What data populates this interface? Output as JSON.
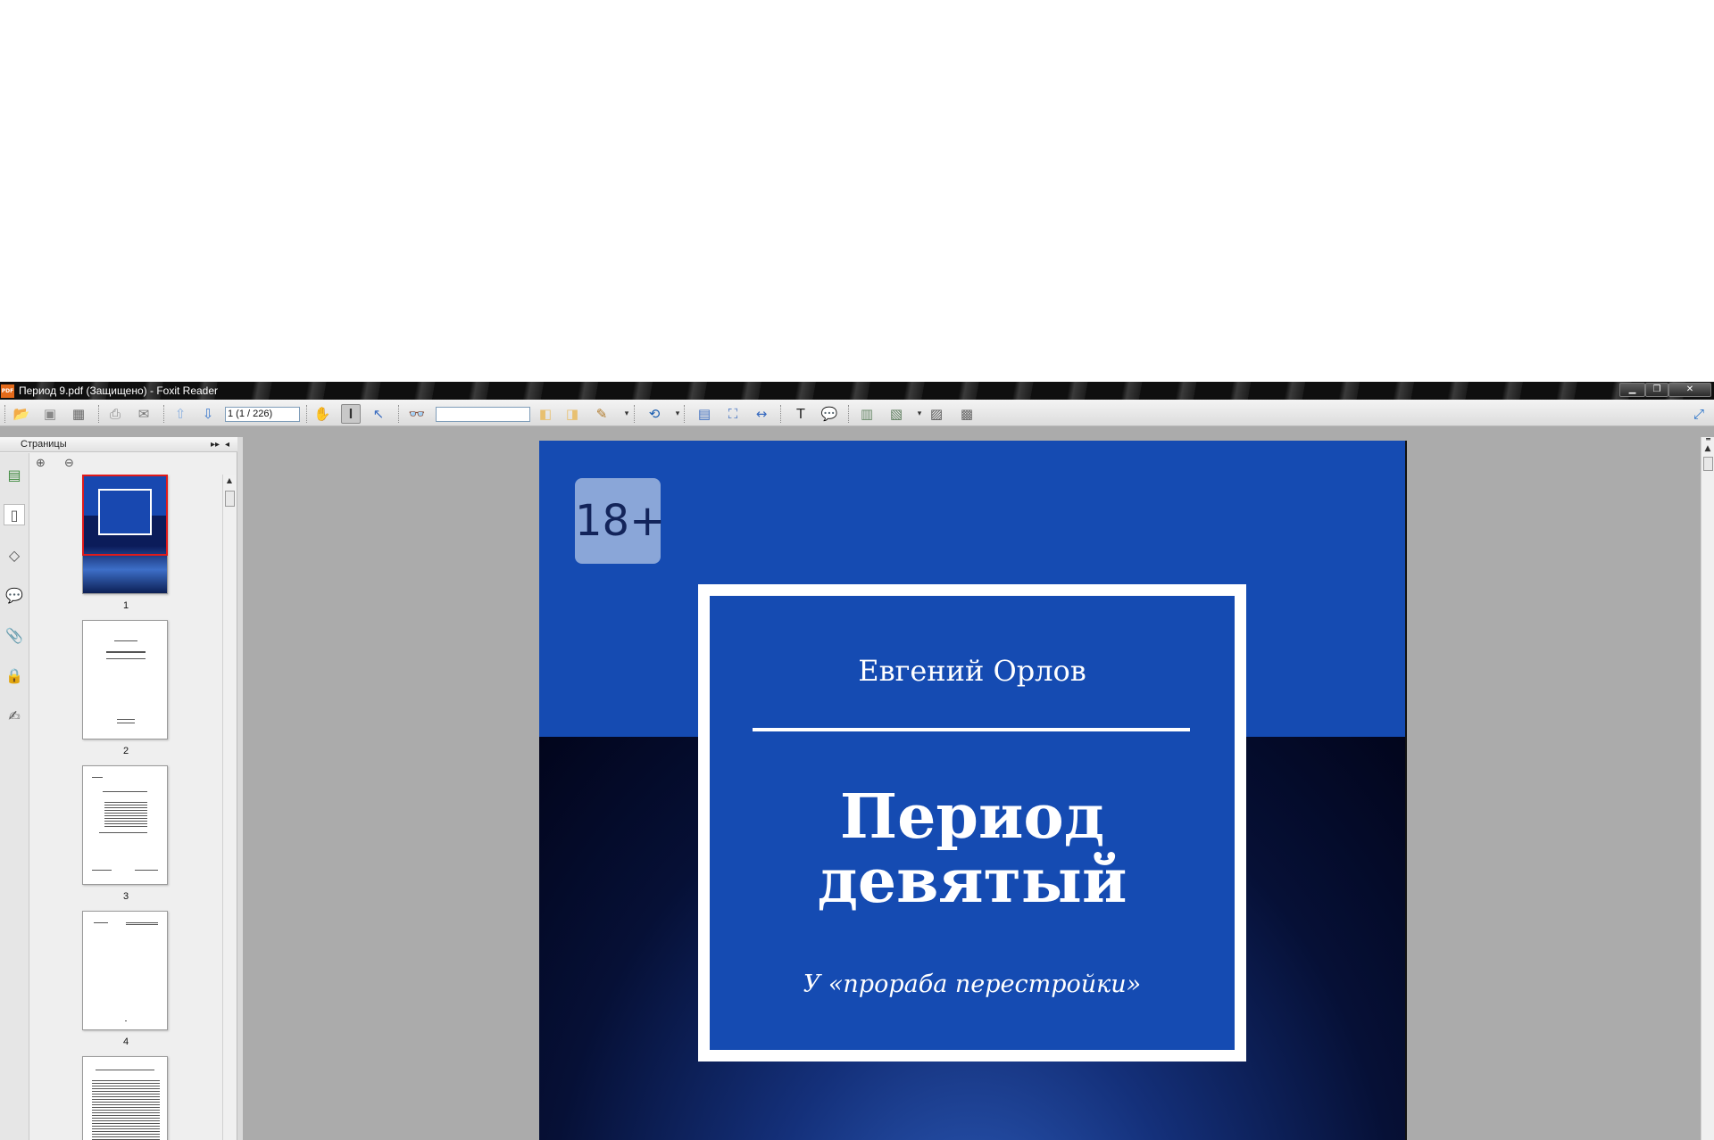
{
  "window": {
    "title": "Период 9.pdf (Защищено) - Foxit Reader",
    "app_icon_text": "PDF",
    "minimize": "▁",
    "maximize": "❐",
    "close": "✕"
  },
  "toolbar": {
    "page_field_value": "1 (1 / 226)",
    "find_field_value": ""
  },
  "side_panel": {
    "title": "Страницы",
    "expand": "▸▸",
    "collapse": "◂"
  },
  "thumbnails": [
    {
      "label": "1",
      "selected": true
    },
    {
      "label": "2",
      "selected": false
    },
    {
      "label": "3",
      "selected": false
    },
    {
      "label": "4",
      "selected": false
    }
  ],
  "document": {
    "age_badge": "18+",
    "author": "Евгений Орлов",
    "title_line1": "Период",
    "title_line2": "девятый",
    "subtitle": "У «прораба перестройки»"
  },
  "colors": {
    "cover_blue": "#154bb2",
    "age_badge": "#8aa6d8",
    "selection_border": "#e01a1a"
  }
}
